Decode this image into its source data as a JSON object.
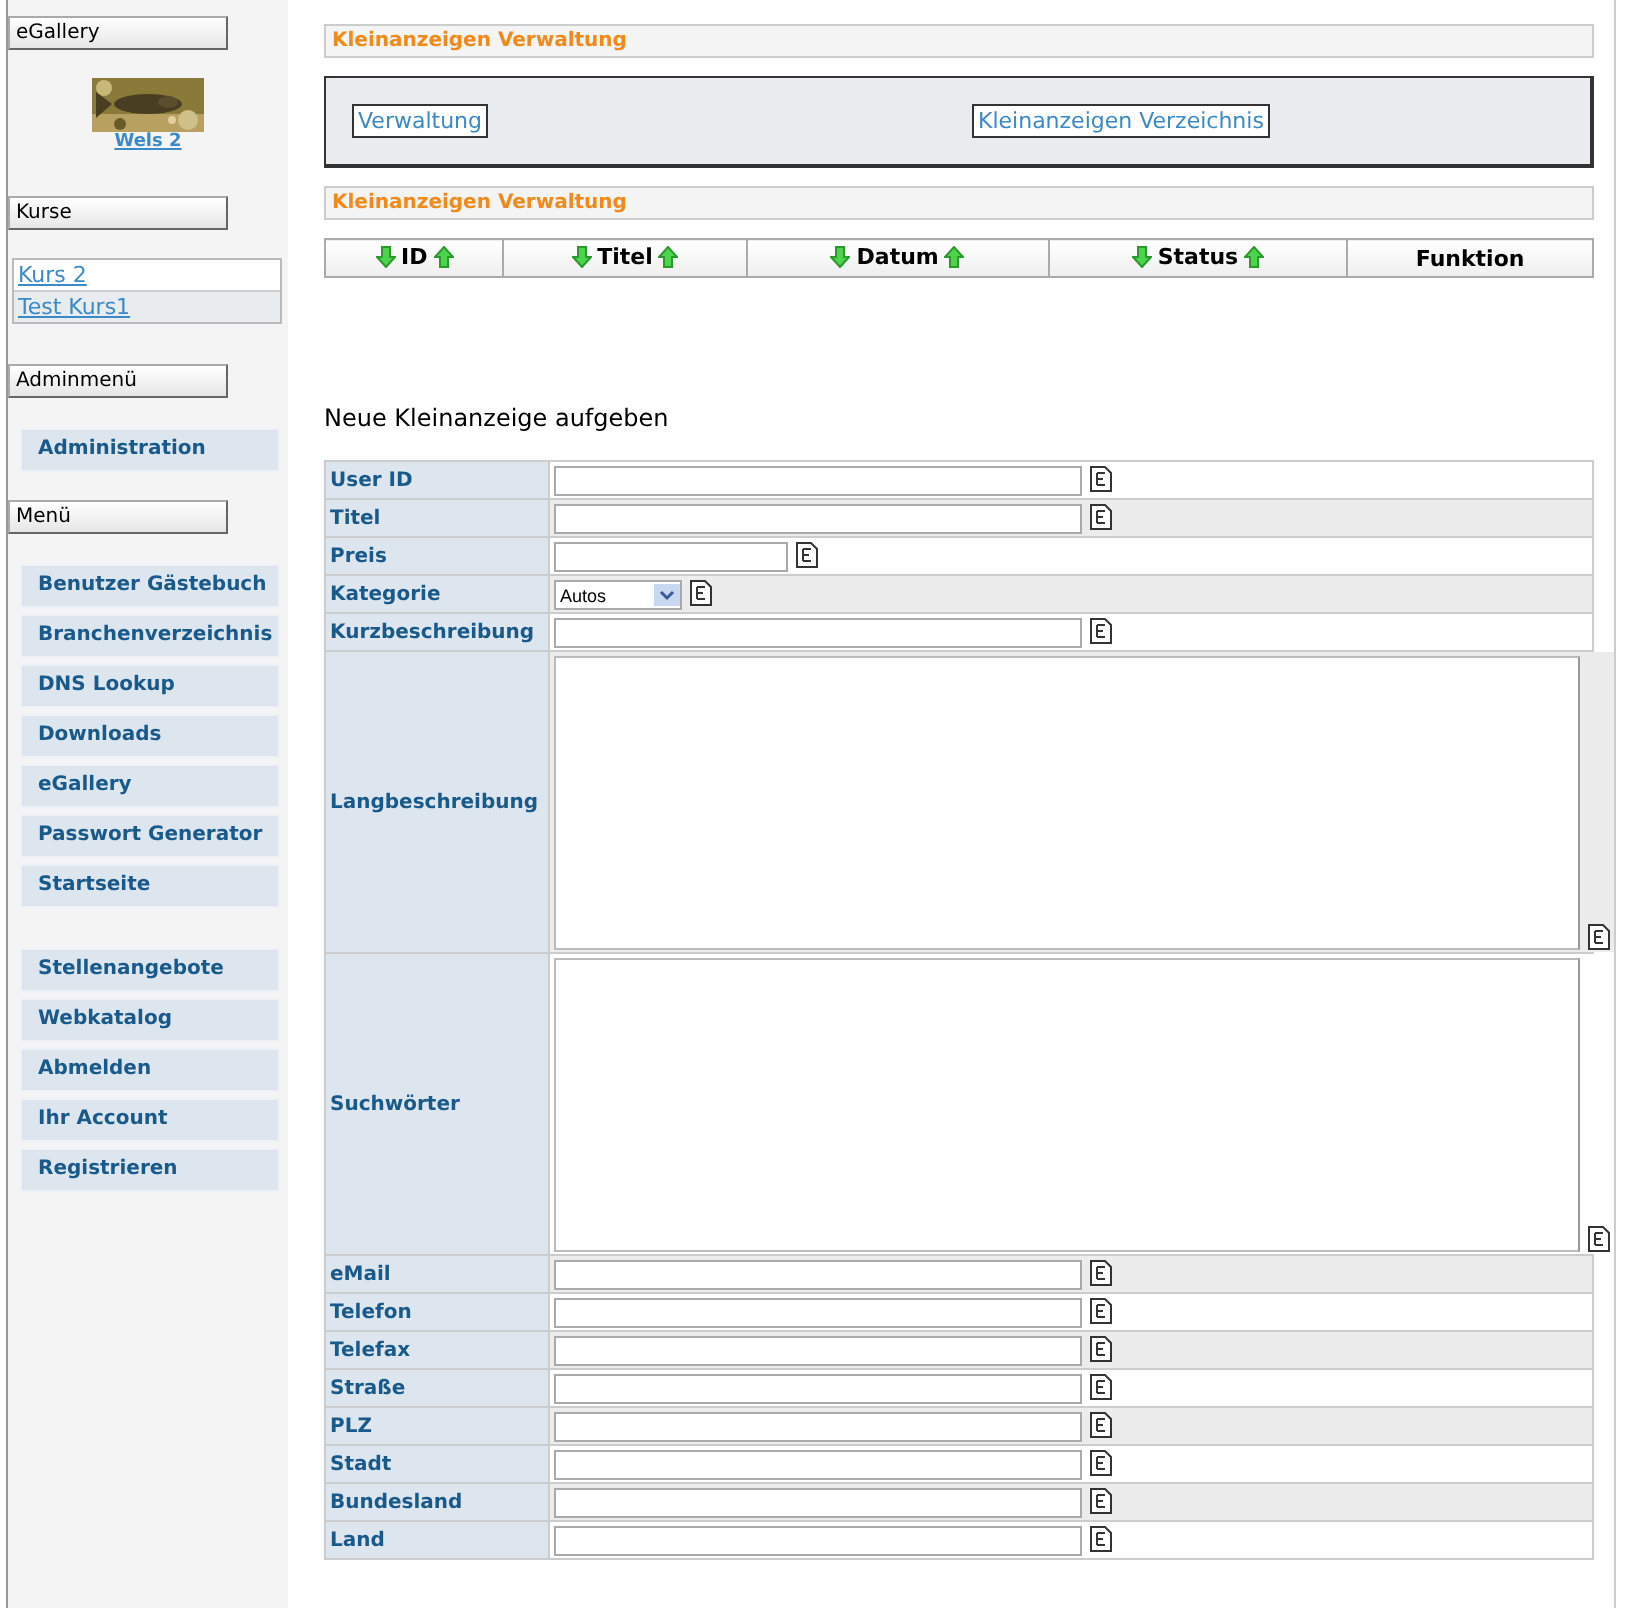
{
  "sidebar": {
    "sections": [
      {
        "heading": "eGallery",
        "kind": "gallery",
        "picture": {
          "kind": "picture",
          "caption": "Wels 2"
        }
      },
      {
        "heading": "Kurse",
        "kind": "links",
        "links": [
          "Kurs 2",
          "Test Kurs1"
        ]
      },
      {
        "heading": "Adminmenü",
        "kind": "menu",
        "groups": [
          {
            "items": [
              "Administration"
            ]
          }
        ]
      },
      {
        "heading": "Menü",
        "kind": "menu",
        "groups": [
          {
            "items": [
              "Benutzer Gästebuch",
              "Branchenverzeichnis",
              "DNS Lookup",
              "Downloads",
              "eGallery",
              "Passwort Generator",
              "Startseite"
            ]
          },
          {
            "items": [
              "Stellenangebote",
              "Webkatalog",
              "Abmelden",
              "Ihr Account",
              "Registrieren"
            ]
          }
        ]
      }
    ]
  },
  "main": {
    "header": "Kleinanzeigen Verwaltung",
    "nav_links": [
      "Verwaltung",
      "Kleinanzeigen Verzeichnis"
    ],
    "list_header": "Kleinanzeigen Verwaltung",
    "table": {
      "columns": [
        {
          "label": "ID",
          "sortable": true
        },
        {
          "label": "Titel",
          "sortable": true
        },
        {
          "label": "Datum",
          "sortable": true
        },
        {
          "label": "Status",
          "sortable": true
        },
        {
          "label": "Funktion",
          "sortable": false
        }
      ]
    },
    "form": {
      "title": "Neue Kleinanzeige aufgeben",
      "fields": [
        {
          "label": "User ID",
          "kind": "text"
        },
        {
          "label": "Titel",
          "kind": "text"
        },
        {
          "label": "Preis",
          "kind": "short"
        },
        {
          "label": "Kategorie",
          "kind": "select",
          "value": "Autos"
        },
        {
          "label": "Kurzbeschreibung",
          "kind": "text"
        },
        {
          "label": "Langbeschreibung",
          "kind": "textarea"
        },
        {
          "label": "Suchwörter",
          "kind": "textarea"
        },
        {
          "label": "eMail",
          "kind": "text"
        },
        {
          "label": "Telefon",
          "kind": "text"
        },
        {
          "label": "Telefax",
          "kind": "text"
        },
        {
          "label": "Straße",
          "kind": "text"
        },
        {
          "label": "PLZ",
          "kind": "text"
        },
        {
          "label": "Stadt",
          "kind": "text"
        },
        {
          "label": "Bundesland",
          "kind": "text"
        },
        {
          "label": "Land",
          "kind": "text"
        }
      ]
    }
  }
}
